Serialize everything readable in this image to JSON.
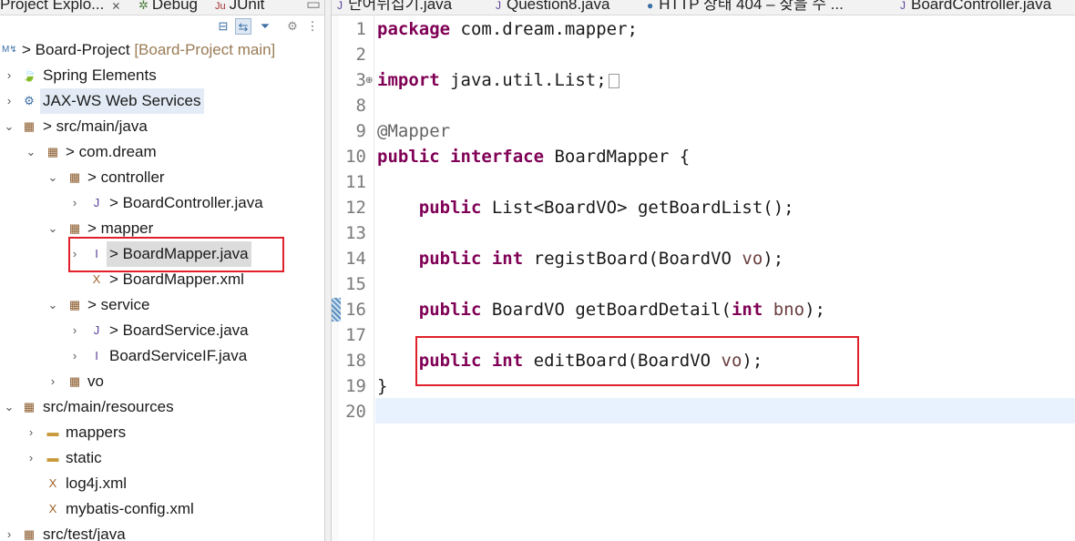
{
  "explorer": {
    "tabs": [
      {
        "label": "Project Explo...",
        "close": "⨯",
        "icon": "package-explorer-icon"
      },
      {
        "label": "Debug",
        "icon": "debug-icon"
      },
      {
        "label": "JUnit",
        "icon": "junit-icon"
      }
    ],
    "tree": [
      {
        "label": "> Board-Project",
        "suffix": "[Board-Project main]",
        "icon": "project-icon"
      },
      {
        "label": "Spring Elements",
        "icon": "spring-leaf-icon"
      },
      {
        "label": "JAX-WS Web Services",
        "icon": "web-services-icon"
      },
      {
        "label": "> src/main/java",
        "icon": "source-folder-icon"
      },
      {
        "label": "> com.dream",
        "icon": "package-icon"
      },
      {
        "label": "> controller",
        "icon": "package-icon"
      },
      {
        "label": "> BoardController.java",
        "icon": "java-file-icon"
      },
      {
        "label": "> mapper",
        "icon": "package-icon"
      },
      {
        "label": "> BoardMapper.java",
        "icon": "java-interface-file-icon"
      },
      {
        "label": "> BoardMapper.xml",
        "icon": "xml-file-icon"
      },
      {
        "label": "> service",
        "icon": "package-icon"
      },
      {
        "label": "> BoardService.java",
        "icon": "java-file-icon"
      },
      {
        "label": "BoardServiceIF.java",
        "icon": "java-interface-file-icon"
      },
      {
        "label": "vo",
        "icon": "package-icon"
      },
      {
        "label": "src/main/resources",
        "icon": "source-folder-icon"
      },
      {
        "label": "mappers",
        "icon": "folder-icon"
      },
      {
        "label": "static",
        "icon": "folder-icon"
      },
      {
        "label": "log4j.xml",
        "icon": "xml-file-icon"
      },
      {
        "label": "mybatis-config.xml",
        "icon": "xml-file-icon"
      },
      {
        "label": "src/test/java",
        "icon": "source-folder-icon"
      }
    ]
  },
  "editor": {
    "tabs": [
      {
        "label": "단어뒤집기.java",
        "icon": "java-file-icon"
      },
      {
        "label": "Question8.java",
        "icon": "java-file-icon"
      },
      {
        "label": "HTTP 상태 404 – 찾을 수 ...",
        "icon": "browser-icon"
      },
      {
        "label": "BoardController.java",
        "icon": "java-file-icon"
      }
    ],
    "line_numbers": [
      "1",
      "2",
      "3",
      "8",
      "9",
      "10",
      "11",
      "12",
      "13",
      "14",
      "15",
      "16",
      "17",
      "18",
      "19",
      "20"
    ],
    "code": {
      "l1_kw": "package",
      "l1_rest": " com.dream.mapper;",
      "l3_kw": "import",
      "l3_rest": " java.util.List;",
      "l9_ann": "@Mapper",
      "l10_kw1": "public",
      "l10_kw2": "interface",
      "l10_rest": " BoardMapper {",
      "l12_kw": "public",
      "l12_rest": " List<BoardVO> getBoardList();",
      "l14_kw1": "public",
      "l14_kw2": "int",
      "l14_rest": " registBoard(BoardVO ",
      "l14_param": "vo",
      "l14_end": ");",
      "l16_kw": "public",
      "l16_mid": " BoardVO getBoardDetail(",
      "l16_kw2": "int",
      "l16_param": "bno",
      "l16_end": ");",
      "l18_kw1": "public",
      "l18_kw2": "int",
      "l18_rest": " editBoard(BoardVO ",
      "l18_param": "vo",
      "l18_end": ");",
      "l19": "}"
    }
  },
  "colors": {
    "keyword": "#7f0055",
    "annotation_box": "#e0202a",
    "current_line": "#e8f2fe"
  }
}
